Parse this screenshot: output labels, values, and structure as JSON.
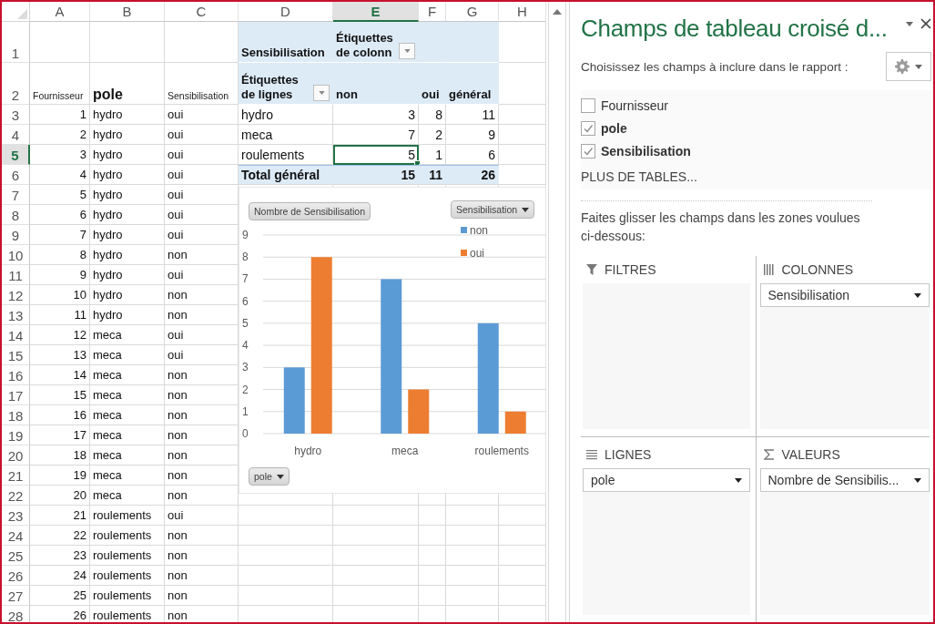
{
  "sheet": {
    "columns": [
      {
        "label": "A",
        "selected": false
      },
      {
        "label": "B",
        "selected": false
      },
      {
        "label": "C",
        "selected": false
      },
      {
        "label": "D",
        "selected": false
      },
      {
        "label": "E",
        "selected": true
      },
      {
        "label": "F",
        "selected": false
      },
      {
        "label": "G",
        "selected": false
      },
      {
        "label": "H",
        "selected": false
      }
    ],
    "row_numbers": [
      {
        "label": "1",
        "selected": false
      },
      {
        "label": "2",
        "selected": false
      },
      {
        "label": "3",
        "selected": false
      },
      {
        "label": "4",
        "selected": false
      },
      {
        "label": "5",
        "selected": true
      },
      {
        "label": "6",
        "selected": false
      },
      {
        "label": "7",
        "selected": false
      },
      {
        "label": "8",
        "selected": false
      },
      {
        "label": "9",
        "selected": false
      },
      {
        "label": "10",
        "selected": false
      },
      {
        "label": "11",
        "selected": false
      },
      {
        "label": "12",
        "selected": false
      },
      {
        "label": "13",
        "selected": false
      },
      {
        "label": "14",
        "selected": false
      },
      {
        "label": "15",
        "selected": false
      },
      {
        "label": "16",
        "selected": false
      },
      {
        "label": "17",
        "selected": false
      },
      {
        "label": "18",
        "selected": false
      },
      {
        "label": "19",
        "selected": false
      },
      {
        "label": "20",
        "selected": false
      },
      {
        "label": "21",
        "selected": false
      },
      {
        "label": "22",
        "selected": false
      },
      {
        "label": "23",
        "selected": false
      },
      {
        "label": "24",
        "selected": false
      },
      {
        "label": "25",
        "selected": false
      },
      {
        "label": "26",
        "selected": false
      },
      {
        "label": "27",
        "selected": false
      },
      {
        "label": "28",
        "selected": false
      }
    ]
  },
  "source_table": {
    "headers": [
      "Fournisseur",
      "pole",
      "Sensibilisation"
    ],
    "rows": [
      [
        "1",
        "hydro",
        "oui"
      ],
      [
        "2",
        "hydro",
        "oui"
      ],
      [
        "3",
        "hydro",
        "oui"
      ],
      [
        "4",
        "hydro",
        "oui"
      ],
      [
        "5",
        "hydro",
        "oui"
      ],
      [
        "6",
        "hydro",
        "oui"
      ],
      [
        "7",
        "hydro",
        "oui"
      ],
      [
        "8",
        "hydro",
        "non"
      ],
      [
        "9",
        "hydro",
        "oui"
      ],
      [
        "10",
        "hydro",
        "non"
      ],
      [
        "11",
        "hydro",
        "non"
      ],
      [
        "12",
        "meca",
        "oui"
      ],
      [
        "13",
        "meca",
        "oui"
      ],
      [
        "14",
        "meca",
        "non"
      ],
      [
        "15",
        "meca",
        "non"
      ],
      [
        "16",
        "meca",
        "non"
      ],
      [
        "17",
        "meca",
        "non"
      ],
      [
        "18",
        "meca",
        "non"
      ],
      [
        "19",
        "meca",
        "non"
      ],
      [
        "20",
        "meca",
        "non"
      ],
      [
        "21",
        "roulements",
        "oui"
      ],
      [
        "22",
        "roulements",
        "non"
      ],
      [
        "23",
        "roulements",
        "non"
      ],
      [
        "24",
        "roulements",
        "non"
      ],
      [
        "25",
        "roulements",
        "non"
      ],
      [
        "26",
        "roulements",
        "non"
      ]
    ]
  },
  "pivot_table": {
    "value_field": "Sensibilisation",
    "column_labels": "Étiquettes de colonn",
    "row_labels": "Étiquettes de lignes",
    "columns": [
      "non",
      "oui",
      "général"
    ],
    "rows": [
      {
        "label": "hydro",
        "values": [
          {
            "text": "3",
            "selected": false
          },
          {
            "text": "8",
            "selected": false
          },
          {
            "text": "11",
            "selected": false
          }
        ]
      },
      {
        "label": "meca",
        "values": [
          {
            "text": "7",
            "selected": false
          },
          {
            "text": "2",
            "selected": false
          },
          {
            "text": "9",
            "selected": false
          }
        ]
      },
      {
        "label": "roulements",
        "values": [
          {
            "text": "5",
            "selected": true
          },
          {
            "text": "1",
            "selected": false
          },
          {
            "text": "6",
            "selected": false
          }
        ]
      }
    ],
    "total": {
      "label": "Total général",
      "values": [
        "15",
        "11",
        "26"
      ]
    }
  },
  "pivot_chart": {
    "value_button": "Nombre de Sensibilisation",
    "legend_button": "Sensibilisation",
    "axis_button": "pole",
    "chart_data": {
      "type": "bar",
      "categories": [
        "hydro",
        "meca",
        "roulements"
      ],
      "series": [
        {
          "name": "non",
          "color": "#5b9bd5",
          "values": [
            3,
            7,
            5
          ]
        },
        {
          "name": "oui",
          "color": "#ed7d31",
          "values": [
            8,
            2,
            1
          ]
        }
      ],
      "ylim": [
        0,
        9
      ],
      "yticks": [
        0,
        1,
        2,
        3,
        4,
        5,
        6,
        7,
        8,
        9
      ],
      "grid": true,
      "legend": true
    }
  },
  "field_pane": {
    "title": "Champs de tableau croisé d...",
    "subtitle": "Choisissez les champs à inclure dans le rapport :",
    "fields": [
      {
        "label": "Fournisseur",
        "checked": false
      },
      {
        "label": "pole",
        "checked": true
      },
      {
        "label": "Sensibilisation",
        "checked": true
      }
    ],
    "more_tables": "PLUS DE TABLES...",
    "instructions": "Faites glisser les champs dans les zones voulues ci-dessous:",
    "areas": [
      {
        "kind": "filters",
        "title": "FILTRES"
      },
      {
        "kind": "columns",
        "title": "COLONNES",
        "fields": [
          "Sensibilisation"
        ]
      },
      {
        "kind": "rows",
        "title": "LIGNES",
        "fields": [
          "pole"
        ]
      },
      {
        "kind": "values",
        "title": "VALEURS",
        "fields": [
          "Nombre de Sensibilis..."
        ]
      }
    ]
  }
}
